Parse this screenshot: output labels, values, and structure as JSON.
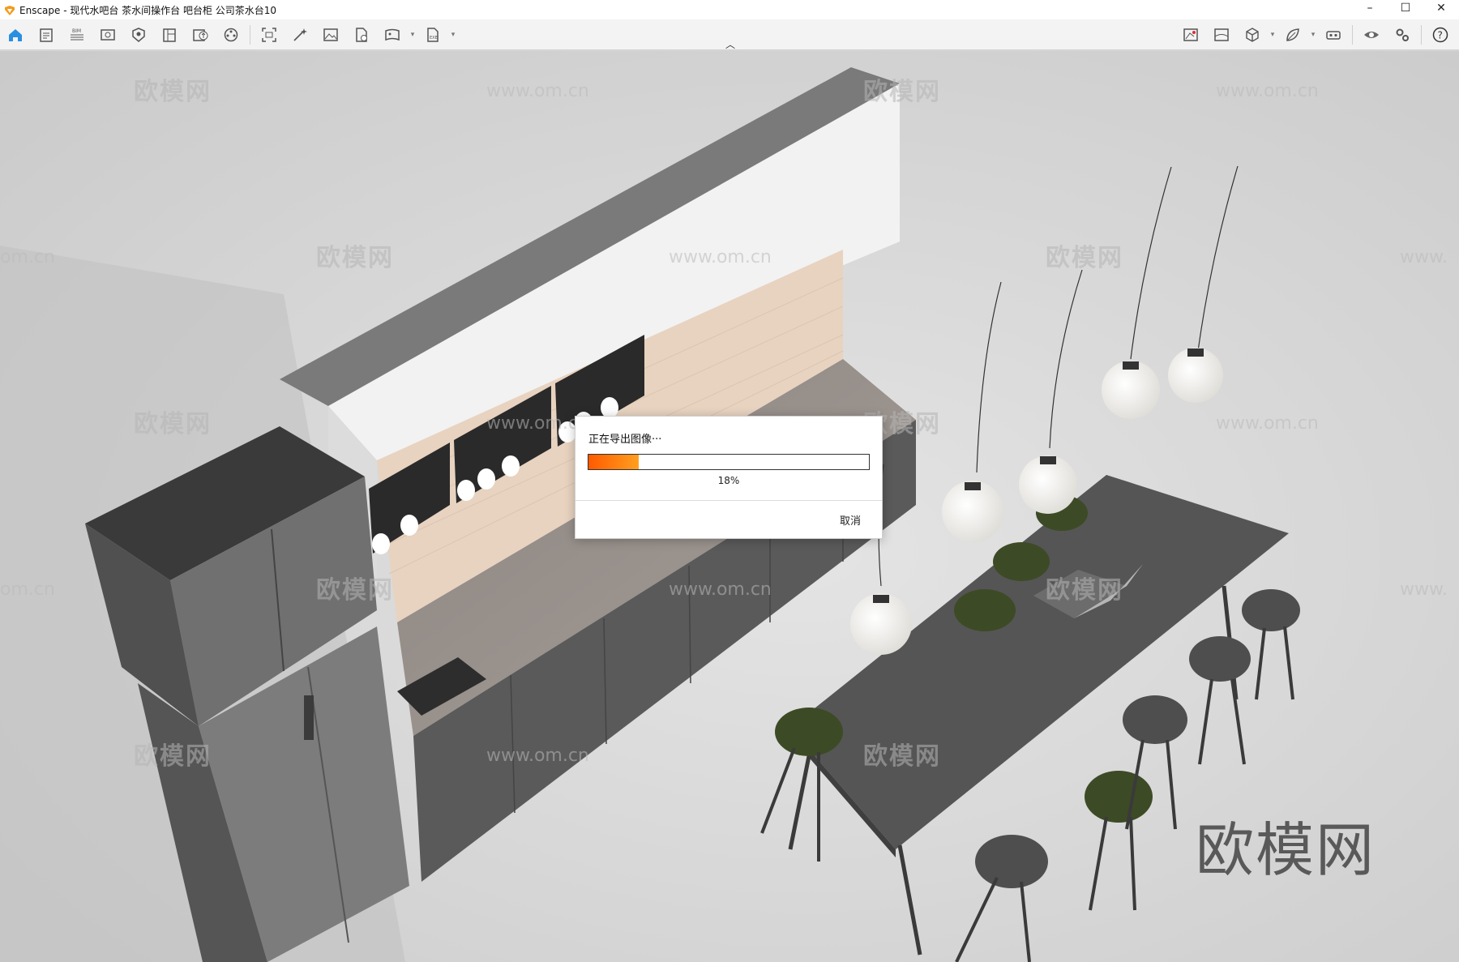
{
  "window": {
    "title": "Enscape - 现代水吧台 茶水间操作台 吧台柜 公司茶水台10",
    "minimize": "–",
    "maximize": "☐",
    "close": "✕"
  },
  "toolbar": {
    "left_buttons": [
      {
        "name": "home-icon"
      },
      {
        "name": "project-info-icon"
      },
      {
        "name": "bim-icon",
        "label": "BIM"
      },
      {
        "name": "views-icon"
      },
      {
        "name": "materials-icon"
      },
      {
        "name": "library-icon"
      },
      {
        "name": "upload-icon"
      },
      {
        "name": "assets-icon"
      },
      {
        "name": "screenshot-icon"
      },
      {
        "name": "magic-icon"
      },
      {
        "name": "gallery-icon"
      },
      {
        "name": "render-icon"
      },
      {
        "name": "panorama-icon"
      },
      {
        "name": "export-icon"
      }
    ],
    "right_buttons": [
      {
        "name": "map-icon"
      },
      {
        "name": "image-icon"
      },
      {
        "name": "cube-icon"
      },
      {
        "name": "leaf-icon"
      },
      {
        "name": "vr-icon"
      },
      {
        "name": "eye-icon"
      },
      {
        "name": "settings-icon"
      },
      {
        "name": "help-icon"
      }
    ],
    "collapse": "︿"
  },
  "watermarks": {
    "brand": "欧模网",
    "url": "www.om.cn",
    "partial_url": "om.cn",
    "partial_www": "www."
  },
  "export_dialog": {
    "title": "正在导出图像···",
    "progress_percent": 18,
    "progress_text": "18%",
    "cancel_label": "取消",
    "accent": "#ff6a00"
  }
}
